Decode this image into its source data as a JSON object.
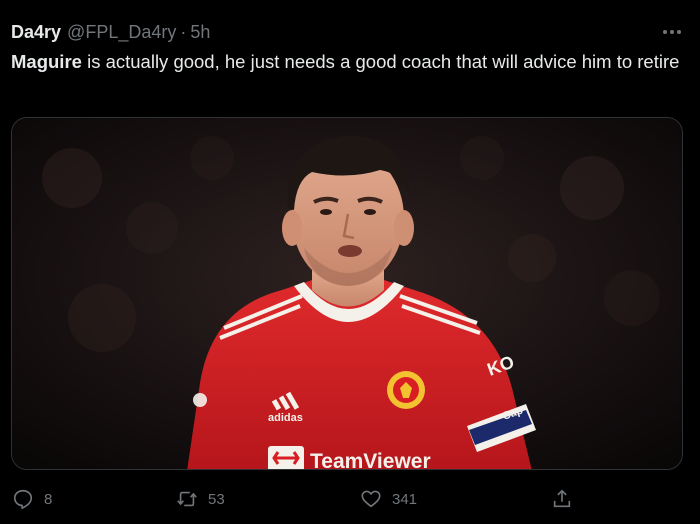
{
  "tweet": {
    "author_name": "Da4ry",
    "author_handle": "@FPL_Da4ry",
    "separator": "·",
    "time": "5h",
    "text_bold": "Maguire",
    "text_rest": " is actually good, he just needs a good coach that will advice him to retire"
  },
  "media": {
    "description_icon": "photo-icon",
    "shirt_sponsor": "TeamViewer",
    "shirt_brand": "adidas",
    "sleeve_text": "KO",
    "armband_text": "Cap"
  },
  "actions": {
    "reply_count": "8",
    "retweet_count": "53",
    "like_count": "341"
  },
  "colors": {
    "background": "#000000",
    "text_primary": "#e7e9ea",
    "text_secondary": "#71767b",
    "shirt_red": "#d81e23"
  }
}
